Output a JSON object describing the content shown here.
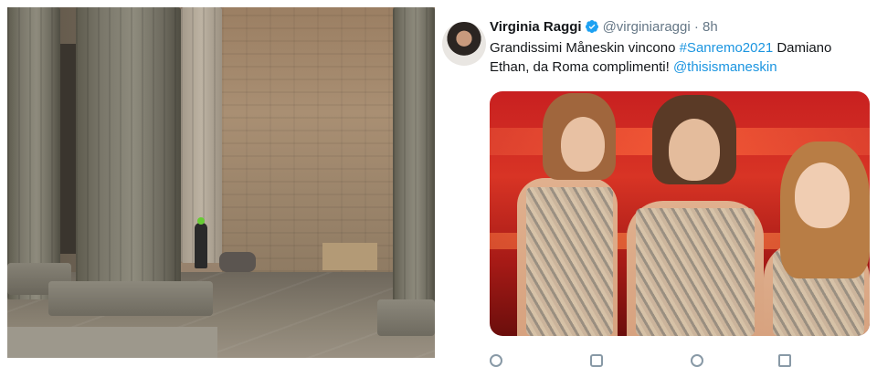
{
  "tweet": {
    "author_name": "Virginia Raggi",
    "handle": "@virginiaraggi",
    "separator": "·",
    "time": "8h",
    "text_before": "Grandissimi Måneskin vincono ",
    "hashtag": "#Sanremo2021",
    "text_middle": " Damiano Ethan, da Roma complimenti! ",
    "mention": "@thisismaneskin"
  },
  "icons": [
    "verified-badge-icon",
    "reply-icon",
    "retweet-icon",
    "like-icon",
    "share-icon"
  ],
  "colors": {
    "link": "#1b95e0",
    "verified": "#1da1f2",
    "name": "#14171a",
    "secondary": "#657786"
  }
}
